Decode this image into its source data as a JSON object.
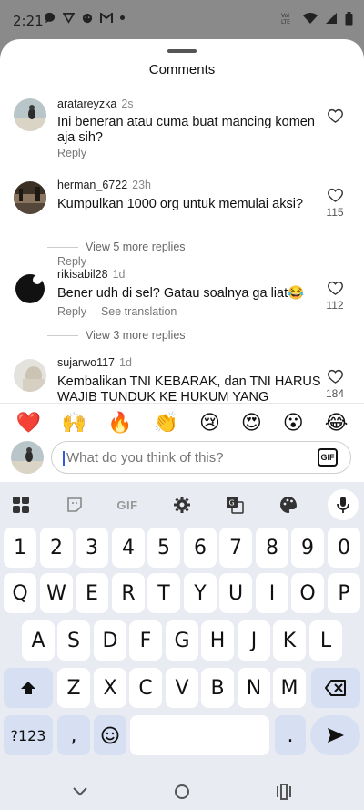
{
  "status": {
    "time": "2:21"
  },
  "sheet": {
    "title": "Comments"
  },
  "comments": [
    {
      "user": "aratareyzka",
      "time": "2s",
      "text": "Ini beneran atau cuma buat mancing komen aja sih?",
      "reply": "Reply",
      "likes": ""
    },
    {
      "user": "herman_6722",
      "time": "23h",
      "text": "Kumpulkan 1000 org untuk memulai aksi?",
      "reply": "Reply",
      "likes": "115",
      "more": "View 5 more replies"
    },
    {
      "user": "rikisabil28",
      "time": "1d",
      "text": "Bener udh di sel? Gatau soalnya ga liat😂",
      "reply": "Reply",
      "translate": "See translation",
      "likes": "112",
      "more": "View 3 more replies"
    },
    {
      "user": "sujarwo117",
      "time": "1d",
      "text": "Kembalikan TNI KEBARAK, dan TNI HARUS WAJIB TUNDUK KE HUKUM YANG",
      "likes": "184"
    }
  ],
  "emojis": [
    "❤️",
    "🙌",
    "🔥",
    "👏",
    "😢",
    "😍",
    "😮",
    "😂"
  ],
  "input": {
    "placeholder": "What do you think of this?",
    "gif": "GIF"
  },
  "keyboard": {
    "toolbar_gif": "GIF",
    "row1": [
      "1",
      "2",
      "3",
      "4",
      "5",
      "6",
      "7",
      "8",
      "9",
      "0"
    ],
    "row2": [
      "Q",
      "W",
      "E",
      "R",
      "T",
      "Y",
      "U",
      "I",
      "O",
      "P"
    ],
    "row3": [
      "A",
      "S",
      "D",
      "F",
      "G",
      "H",
      "J",
      "K",
      "L"
    ],
    "row4": [
      "Z",
      "X",
      "C",
      "V",
      "B",
      "N",
      "M"
    ],
    "symbols": "?123",
    "comma": ",",
    "period": "."
  }
}
